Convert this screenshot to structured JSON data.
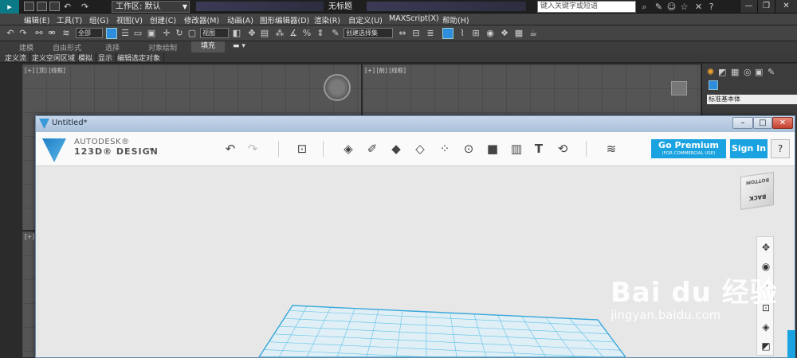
{
  "max": {
    "workspace_label": "工作区: 默认",
    "document_title": "无标题",
    "search_placeholder": "键入关键字或短语",
    "menu": [
      "编辑(E)",
      "工具(T)",
      "组(G)",
      "视图(V)",
      "创建(C)",
      "修改器(M)",
      "动画(A)",
      "图形编辑器(D)",
      "渲染(R)",
      "自定义(U)",
      "MAXScript(X)",
      "帮助(H)"
    ],
    "toolbar_select_filter": "全部",
    "toolbar_view_coord": "视图",
    "toolbar_named_sel": "创建选择集",
    "ribbon_tabs": [
      "建模",
      "自由形式",
      "选择",
      "对象绘制",
      "填充"
    ],
    "subtabs": [
      "定义流",
      "定义空闲区域",
      "模拟",
      "显示",
      "编辑选定对象"
    ],
    "viewport_labels": {
      "top": "[+] [顶] [线框]",
      "front": "[+] [前] [线框]",
      "persp": "[+]"
    },
    "cmd_panel_dropdown": "标准基本体"
  },
  "app": {
    "window_title": "Untitled*",
    "brand_line1": "AUTODESK®",
    "brand_line2": "123D® DESIGN",
    "go_premium": "Go Premium",
    "go_premium_sub": "(FOR COMMERCIAL USE)",
    "sign_in": "Sign In",
    "help": "?",
    "viewcube_top": "BOTTOM",
    "viewcube_back": "BACK"
  },
  "watermark": {
    "main": "Bai du 经验",
    "sub": "jingyan.baidu.com"
  },
  "colors": {
    "accent": "#1aa3e0",
    "grid": "#5bc3ea",
    "max_bg": "#444444"
  }
}
